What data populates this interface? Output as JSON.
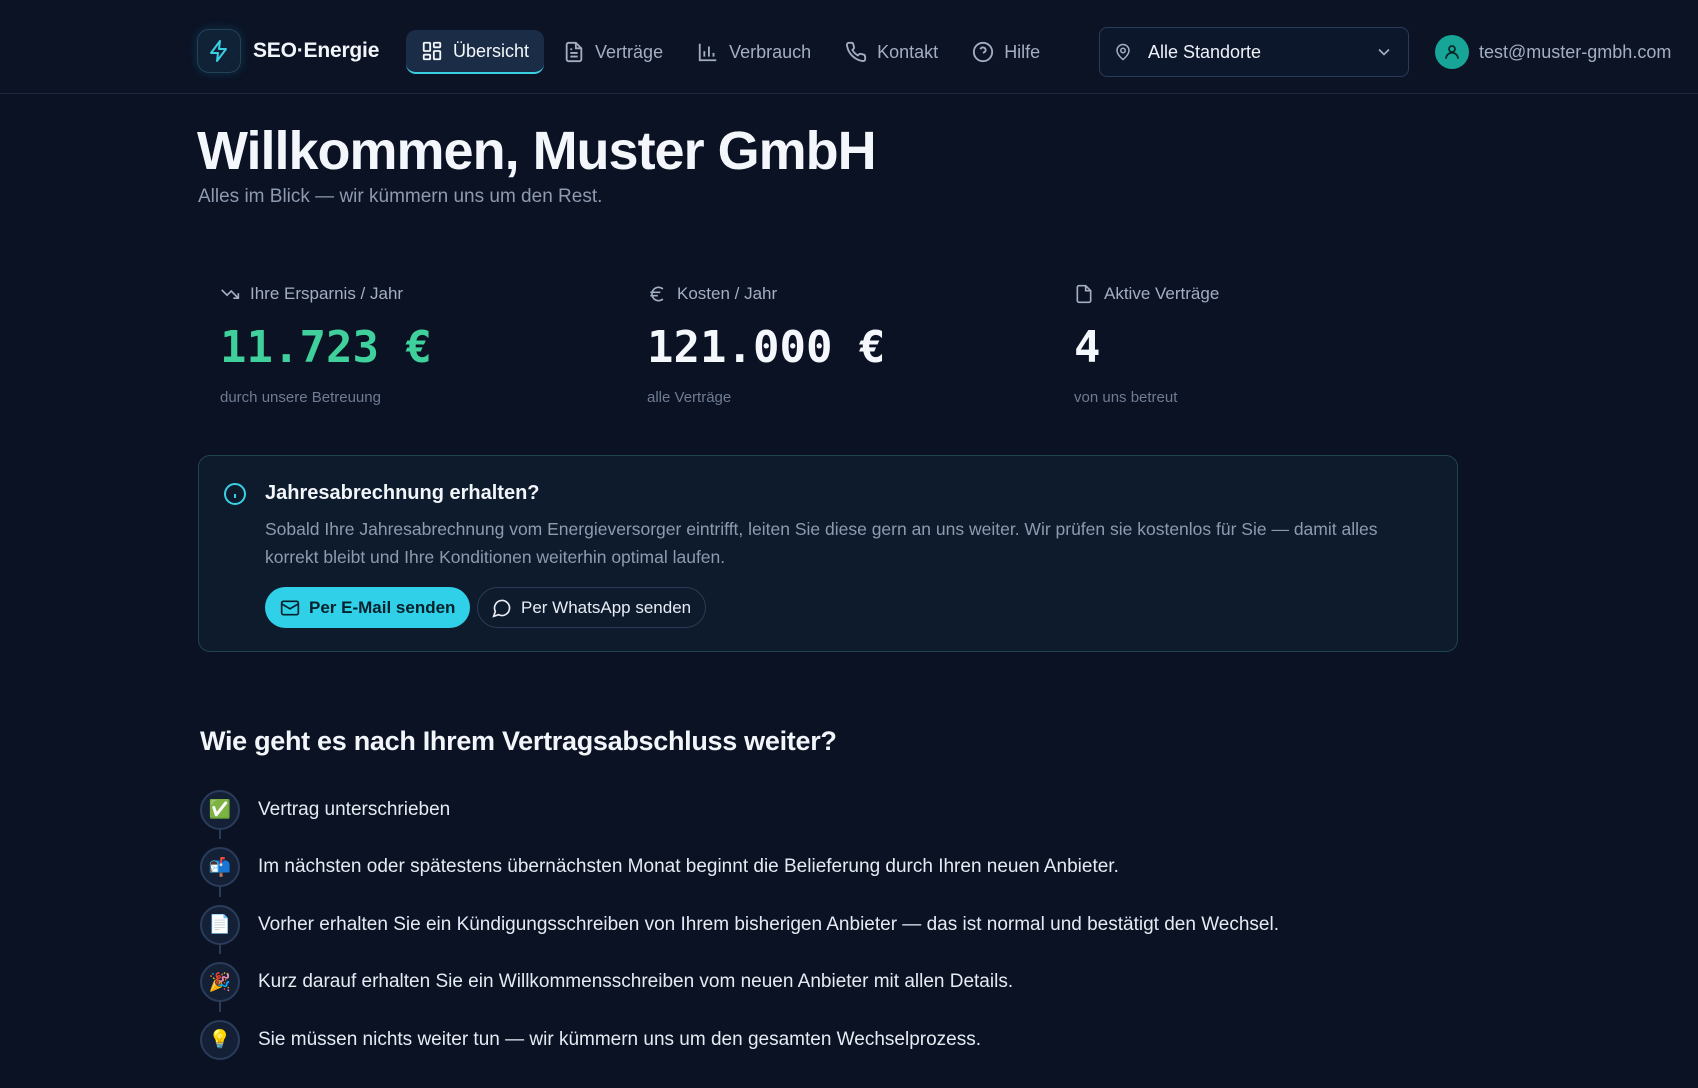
{
  "brand": {
    "name": "SEO·Energie",
    "accent": "#3bcfe3"
  },
  "nav": {
    "items": [
      {
        "label": "Übersicht",
        "icon": "dashboard-icon",
        "active": true
      },
      {
        "label": "Verträge",
        "icon": "document-icon",
        "active": false
      },
      {
        "label": "Verbrauch",
        "icon": "bar-chart-icon",
        "active": false
      },
      {
        "label": "Kontakt",
        "icon": "phone-icon",
        "active": false
      },
      {
        "label": "Hilfe",
        "icon": "help-icon",
        "active": false
      }
    ]
  },
  "location": {
    "selected": "Alle Standorte"
  },
  "user": {
    "email": "test@muster-gmbh.com"
  },
  "welcome": {
    "title": "Willkommen, Muster GmbH",
    "subtitle": "Alles im Blick — wir kümmern uns um den Rest."
  },
  "stats": [
    {
      "label": "Ihre Ersparnis / Jahr",
      "value": "11.723 €",
      "note": "durch unsere Betreuung",
      "icon": "trending-down-icon",
      "color": "#3fd09c"
    },
    {
      "label": "Kosten / Jahr",
      "value": "121.000 €",
      "note": "alle Verträge",
      "icon": "euro-icon",
      "color": "#f4f7fb"
    },
    {
      "label": "Aktive Verträge",
      "value": "4",
      "note": "von uns betreut",
      "icon": "file-icon",
      "color": "#f4f7fb"
    }
  ],
  "info": {
    "title": "Jahresabrechnung erhalten?",
    "text": "Sobald Ihre Jahresabrechnung vom Energieversorger eintrifft, leiten Sie diese gern an uns weiter. Wir prüfen sie kostenlos für Sie — damit alles korrekt bleibt und Ihre Konditionen weiterhin optimal laufen.",
    "email_button": "Per E-Mail senden",
    "whatsapp_button": "Per WhatsApp senden"
  },
  "steps": {
    "title": "Wie geht es nach Ihrem Vertragsabschluss weiter?",
    "items": [
      {
        "emoji": "✅",
        "text": "Vertrag unterschrieben"
      },
      {
        "emoji": "📬",
        "text": "Im nächsten oder spätestens übernächsten Monat beginnt die Belieferung durch Ihren neuen Anbieter."
      },
      {
        "emoji": "📄",
        "text": "Vorher erhalten Sie ein Kündigungsschreiben von Ihrem bisherigen Anbieter — das ist normal und bestätigt den Wechsel."
      },
      {
        "emoji": "🎉",
        "text": "Kurz darauf erhalten Sie ein Willkommensschreiben vom neuen Anbieter mit allen Details."
      },
      {
        "emoji": "💡",
        "text": "Sie müssen nichts weiter tun — wir kümmern uns um den gesamten Wechselprozess."
      }
    ]
  }
}
